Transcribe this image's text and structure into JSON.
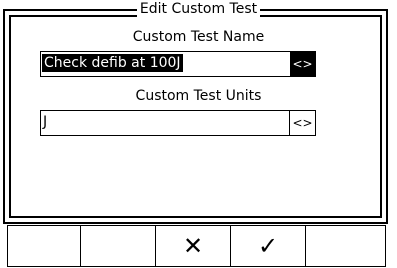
{
  "dialog": {
    "title": "Edit Custom Test",
    "name_label": "Custom Test Name",
    "name_value": "Check defib at 100J",
    "name_edit_button": "<>",
    "units_label": "Custom Test Units",
    "units_value": "J",
    "units_edit_button": "<>"
  },
  "softkeys": {
    "key1": "",
    "key2": "",
    "cancel": "✕",
    "confirm": "✓",
    "key5": ""
  }
}
